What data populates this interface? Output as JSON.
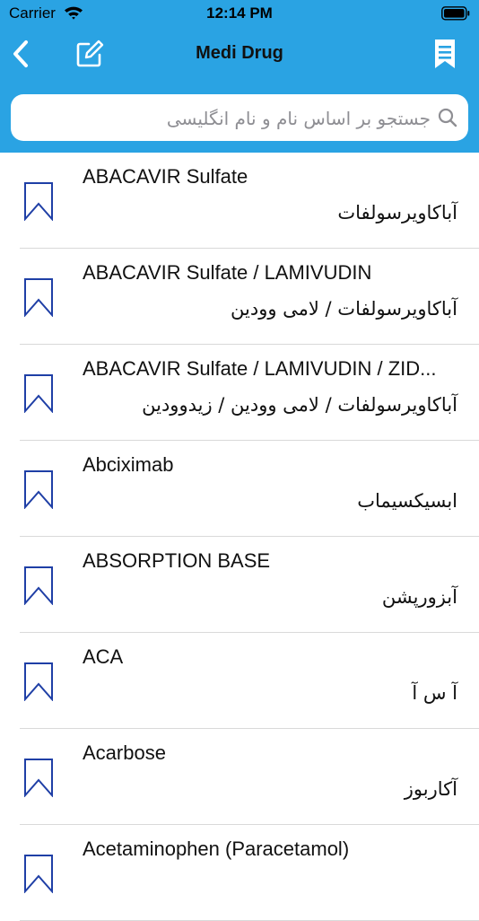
{
  "status_bar": {
    "carrier": "Carrier",
    "time": "12:14 PM"
  },
  "nav": {
    "title": "Medi Drug",
    "back_icon": "chevron-left-icon",
    "edit_icon": "edit-icon",
    "bookmarks_icon": "bookmark-list-icon"
  },
  "search": {
    "placeholder": "جستجو بر اساس نام و نام انگلیسی",
    "value": ""
  },
  "colors": {
    "header": "#2aa3e3",
    "bookmark": "#1f3fa6",
    "separator": "#d9d9d9"
  },
  "drugs": [
    {
      "en": "ABACAVIR Sulfate",
      "fa": "آباکاویرسولفات"
    },
    {
      "en": "ABACAVIR Sulfate / LAMIVUDIN",
      "fa": "آباکاویرسولفات / لامی وودین"
    },
    {
      "en": "ABACAVIR Sulfate / LAMIVUDIN / ZID...",
      "fa": "آباکاویرسولفات / لامی وودین / زیدوودین"
    },
    {
      "en": "Abciximab",
      "fa": "ابسیکسیماب"
    },
    {
      "en": "ABSORPTION BASE",
      "fa": "آبزورپشن"
    },
    {
      "en": "ACA",
      "fa": "آ س آ"
    },
    {
      "en": "Acarbose",
      "fa": "آکاربوز"
    },
    {
      "en": "Acetaminophen (Paracetamol)",
      "fa": ""
    }
  ]
}
